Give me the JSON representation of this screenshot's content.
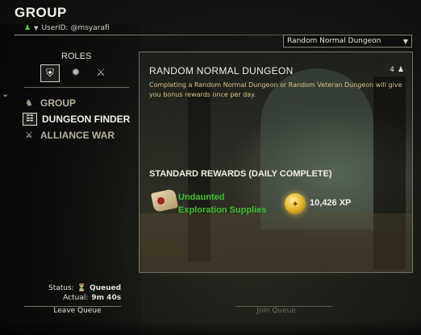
{
  "header": {
    "title": "GROUP",
    "user_id": "UserID: @msyarafi"
  },
  "dropdown": {
    "selected": "Random Normal Dungeon"
  },
  "roles": {
    "label": "ROLES",
    "items": [
      {
        "name": "tank",
        "icon": "shield-icon",
        "active": true
      },
      {
        "name": "healer",
        "icon": "heal-burst-icon",
        "active": false
      },
      {
        "name": "damage",
        "icon": "crossed-swords-icon",
        "active": false
      }
    ]
  },
  "nav": {
    "items": [
      {
        "label": "GROUP",
        "icon": "group-icon"
      },
      {
        "label": "DUNGEON FINDER",
        "icon": "dungeon-finder-icon"
      },
      {
        "label": "ALLIANCE WAR",
        "icon": "alliance-war-icon"
      }
    ],
    "active_index": 1
  },
  "activity": {
    "title": "RANDOM NORMAL DUNGEON",
    "group_size": "4",
    "description": "Completing a Random Normal Dungeon or Random Veteran Dungeon will give you bonus rewards once per day.",
    "rewards_title": "STANDARD REWARDS (DAILY COMPLETE)",
    "reward_item": "Undaunted Exploration Supplies",
    "xp": "10,426 XP"
  },
  "queue": {
    "status_label": "Status:",
    "status_value": "Queued",
    "actual_label": "Actual:",
    "actual_value": "9m 40s",
    "leave_label": "Leave Queue",
    "join_label": "Join Queue"
  },
  "colors": {
    "reward_green": "#43c02d",
    "description_gold": "#d9c38a",
    "online_green": "#4fcf3a"
  }
}
